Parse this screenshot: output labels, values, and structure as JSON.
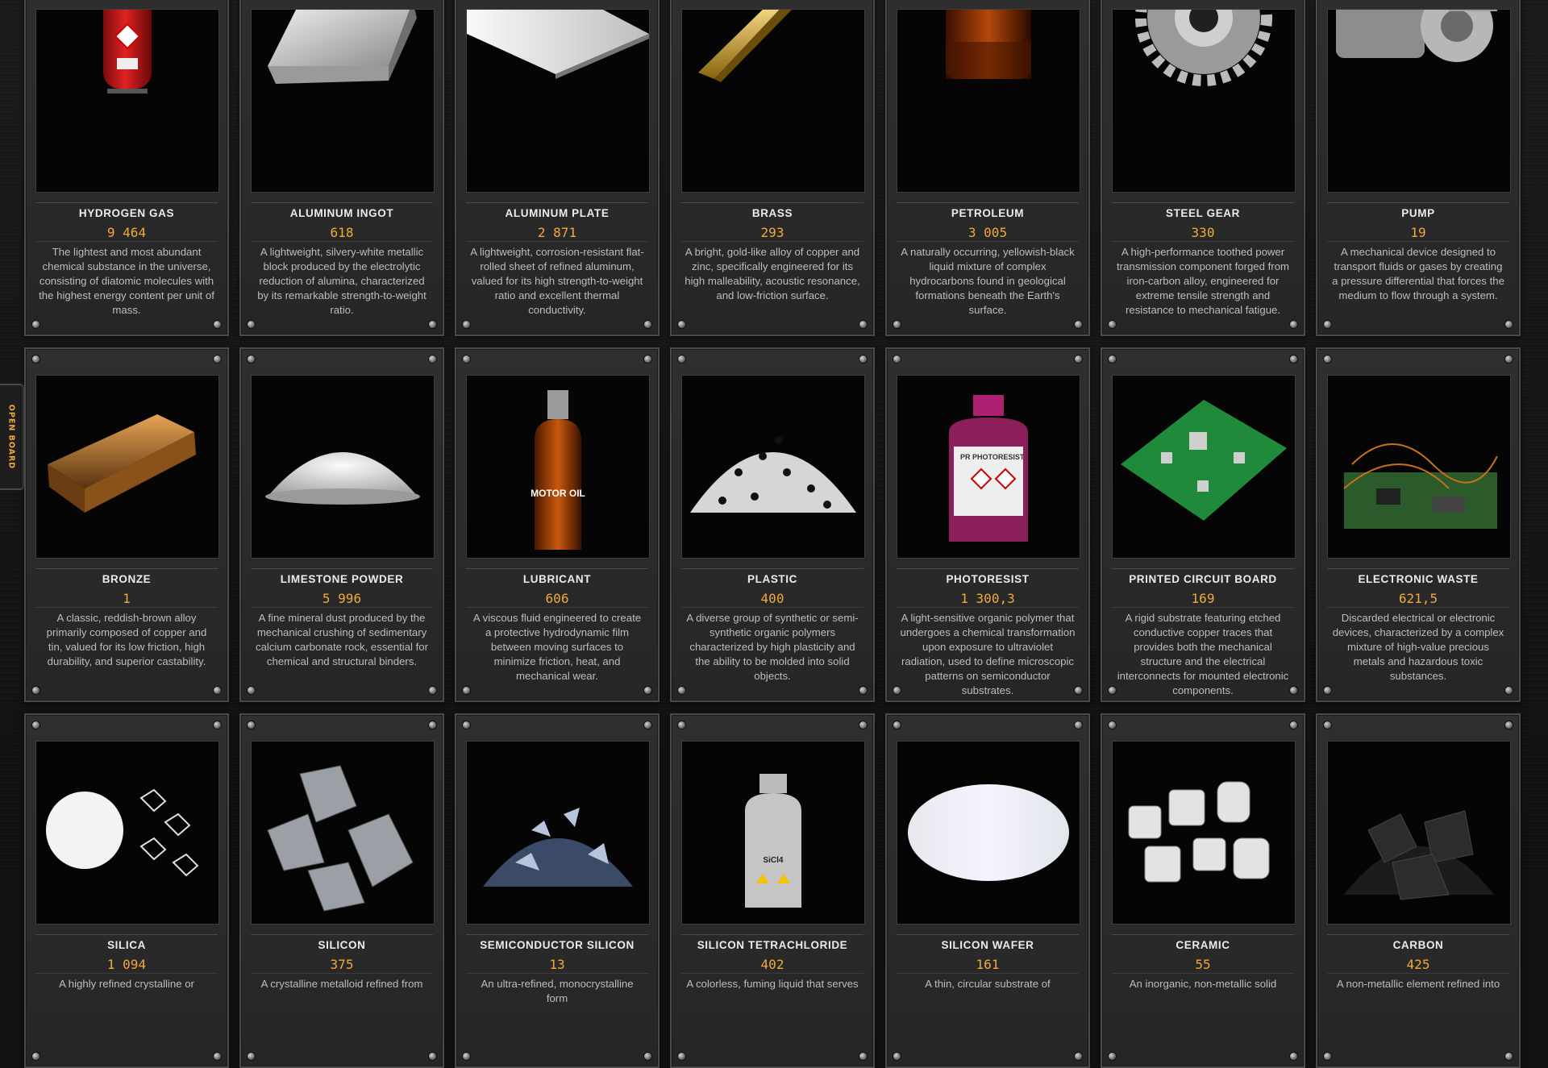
{
  "side_tab": {
    "label": "OPEN BOARD"
  },
  "cards": [
    {
      "name": "HYDROGEN GAS",
      "count": "9 464",
      "desc": "The lightest and most abundant chemical substance in the universe, consisting of diatomic molecules with the highest energy content per unit of mass.",
      "icon": "hydrogen-cylinder-icon"
    },
    {
      "name": "ALUMINUM INGOT",
      "count": "618",
      "desc": "A lightweight, silvery-white metallic block produced by the electrolytic reduction of alumina, characterized by its remarkable strength-to-weight ratio.",
      "icon": "aluminum-ingot-icon"
    },
    {
      "name": "ALUMINUM PLATE",
      "count": "2 871",
      "desc": "A lightweight, corrosion-resistant flat-rolled sheet of refined aluminum, valued for its high strength-to-weight ratio and excellent thermal conductivity.",
      "icon": "aluminum-plate-icon"
    },
    {
      "name": "BRASS",
      "count": "293",
      "desc": "A bright, gold-like alloy of copper and zinc, specifically engineered for its high malleability, acoustic resonance, and low-friction surface.",
      "icon": "brass-bar-icon"
    },
    {
      "name": "PETROLEUM",
      "count": "3 005",
      "desc": "A naturally occurring, yellowish-black liquid mixture of complex hydrocarbons found in geological formations beneath the Earth's surface.",
      "icon": "petroleum-bottle-icon"
    },
    {
      "name": "STEEL GEAR",
      "count": "330",
      "desc": "A high-performance toothed power transmission component forged from iron-carbon alloy, engineered for extreme tensile strength and resistance to mechanical fatigue.",
      "icon": "steel-gear-icon"
    },
    {
      "name": "PUMP",
      "count": "19",
      "desc": "A mechanical device designed to transport fluids or gases by creating a pressure differential that forces the medium to flow through a system.",
      "icon": "pump-icon"
    },
    {
      "name": "BRONZE",
      "count": "1",
      "desc": "A classic, reddish-brown alloy primarily composed of copper and tin, valued for its low friction, high durability, and superior castability.",
      "icon": "bronze-bar-icon"
    },
    {
      "name": "LIMESTONE POWDER",
      "count": "5 996",
      "desc": "A fine mineral dust produced by the mechanical crushing of sedimentary calcium carbonate rock, essential for chemical and structural binders.",
      "icon": "powder-pile-icon"
    },
    {
      "name": "LUBRICANT",
      "count": "606",
      "desc": "A viscous fluid engineered to create a protective hydrodynamic film between moving surfaces to minimize friction, heat, and mechanical wear.",
      "icon": "motor-oil-bottle-icon",
      "img_label": "MOTOR OIL"
    },
    {
      "name": "PLASTIC",
      "count": "400",
      "desc": "A diverse group of synthetic or semi-synthetic organic polymers characterized by high plasticity and the ability to be molded into solid objects.",
      "icon": "plastic-pellets-icon"
    },
    {
      "name": "PHOTORESIST",
      "count": "1 300,3",
      "desc": "A light-sensitive organic polymer that undergoes a chemical transformation upon exposure to ultraviolet radiation, used to define microscopic patterns on semiconductor substrates.",
      "icon": "photoresist-bottle-icon",
      "img_label": "PR PHOTORESIST"
    },
    {
      "name": "PRINTED CIRCUIT BOARD",
      "count": "169",
      "desc": "A rigid substrate featuring etched conductive copper traces that provides both the mechanical structure and the electrical interconnects for mounted electronic components.",
      "icon": "circuit-board-icon"
    },
    {
      "name": "ELECTRONIC WASTE",
      "count": "621,5",
      "desc": "Discarded electrical or electronic devices, characterized by a complex mixture of high-value precious metals and hazardous toxic substances.",
      "icon": "e-waste-icon"
    },
    {
      "name": "SILICA",
      "count": "1 094",
      "desc": "A highly refined crystalline or",
      "icon": "silica-crystals-icon"
    },
    {
      "name": "SILICON",
      "count": "375",
      "desc": "A crystalline metalloid refined from",
      "icon": "silicon-chunks-icon"
    },
    {
      "name": "SEMICONDUCTOR SILICON",
      "count": "13",
      "desc": "An ultra-refined, monocrystalline form",
      "icon": "semiconductor-silicon-icon"
    },
    {
      "name": "SILICON TETRACHLORIDE",
      "count": "402",
      "desc": "A colorless, fuming liquid that serves",
      "icon": "sicl4-bottle-icon",
      "img_label": "SiCl4"
    },
    {
      "name": "SILICON WAFER",
      "count": "161",
      "desc": "A thin, circular substrate of",
      "icon": "silicon-wafer-icon"
    },
    {
      "name": "CERAMIC",
      "count": "55",
      "desc": "An inorganic, non-metallic solid",
      "icon": "ceramic-blocks-icon"
    },
    {
      "name": "CARBON",
      "count": "425",
      "desc": "A non-metallic element refined into",
      "icon": "carbon-chunks-icon"
    }
  ]
}
